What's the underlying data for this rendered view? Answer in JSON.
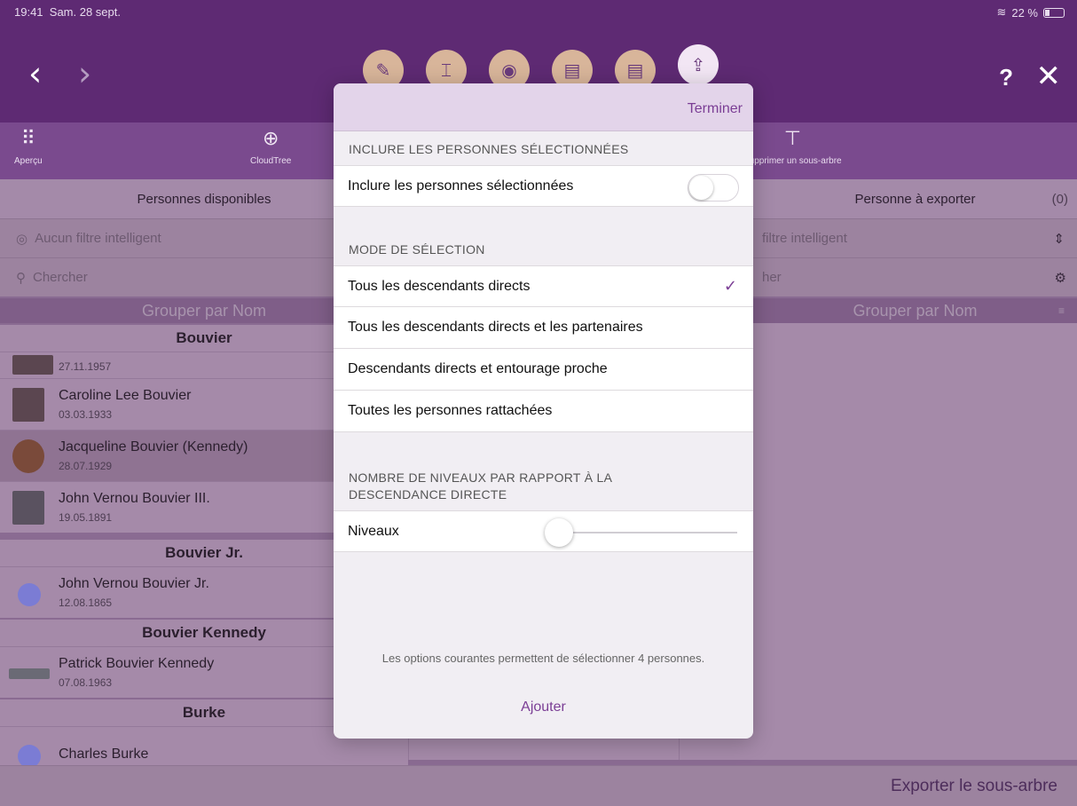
{
  "status": {
    "time": "19:41",
    "date": "Sam. 28 sept.",
    "battery": "22 %"
  },
  "header": {
    "back": "‹",
    "forward": "›",
    "help": "?",
    "close": "✕",
    "actions": [
      "edit-icon",
      "chart-icon",
      "view-icon",
      "document-icon",
      "document-icon",
      "upload-icon"
    ]
  },
  "toolbar": {
    "apercu": "Aperçu",
    "cloudtree": "CloudTree",
    "supprimer": "Supprimer un sous-arbre"
  },
  "left": {
    "title": "Personnes disponibles",
    "filter": "Aucun filtre intelligent",
    "search_placeholder": "Chercher",
    "group": "Grouper par Nom",
    "sections": [
      {
        "name": "Bouvier",
        "people": [
          {
            "name": "",
            "date": "27.11.1957"
          },
          {
            "name": "Caroline Lee Bouvier",
            "date": "03.03.1933"
          },
          {
            "name": "Jacqueline Bouvier (Kennedy)",
            "date": "28.07.1929"
          },
          {
            "name": "John Vernou Bouvier III.",
            "date": "19.05.1891"
          }
        ]
      },
      {
        "name": "Bouvier Jr.",
        "people": [
          {
            "name": "John Vernou Bouvier Jr.",
            "date": "12.08.1865"
          }
        ]
      },
      {
        "name": "Bouvier Kennedy",
        "people": [
          {
            "name": "Patrick Bouvier Kennedy",
            "date": "07.08.1963"
          }
        ]
      },
      {
        "name": "Burke",
        "people": [
          {
            "name": "Charles Burke",
            "date": ""
          }
        ]
      }
    ]
  },
  "right": {
    "title": "Personne à exporter",
    "count": "(0)",
    "filter": "filtre intelligent",
    "search_placeholder": "her",
    "group": "Grouper par Nom"
  },
  "footer": {
    "export": "Exporter le sous-arbre"
  },
  "modal": {
    "done": "Terminer",
    "section1": "INCLURE LES PERSONNES SÉLECTIONNÉES",
    "include_label": "Inclure les personnes sélectionnées",
    "include_on": false,
    "section2": "MODE DE SÉLECTION",
    "modes": [
      "Tous les descendants directs",
      "Tous les descendants directs et les partenaires",
      "Descendants directs et entourage proche",
      "Toutes les personnes rattachées"
    ],
    "selected_mode": 0,
    "section3_line1": "NOMBRE DE NIVEAUX PAR RAPPORT À LA",
    "section3_line2": "DESCENDANCE DIRECTE",
    "levels_label": "Niveaux",
    "levels_value": 0,
    "note": "Les options courantes permettent de sélectionner 4 personnes.",
    "add": "Ajouter"
  },
  "colors": {
    "accent": "#7b3e95",
    "header": "#5e2a73"
  }
}
